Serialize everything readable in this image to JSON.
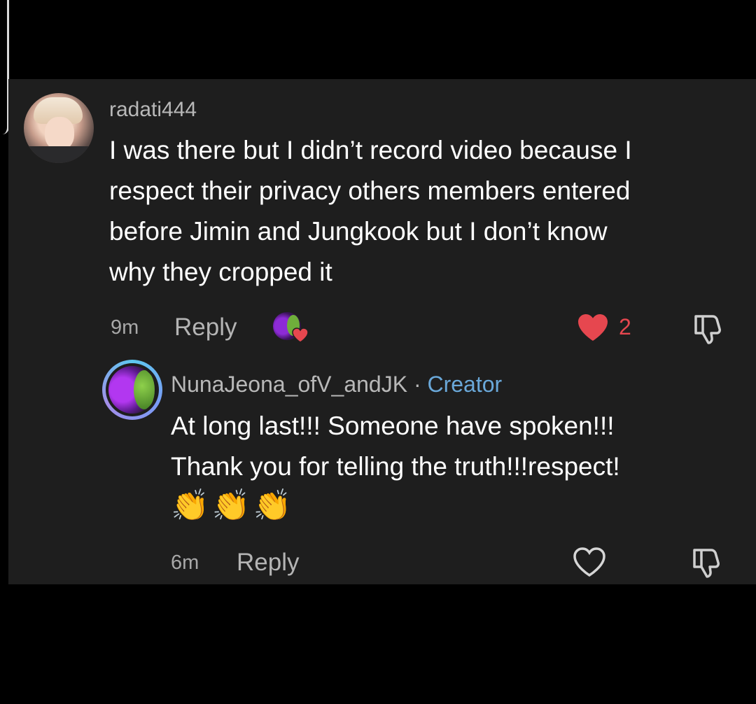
{
  "comment": {
    "username": "radati444",
    "text": "I was there but I didn’t record video because I\nrespect their privacy others members entered\nbefore Jimin and Jungkook but I don’t know\nwhy they cropped it",
    "time": "9m",
    "reply_label": "Reply",
    "like_count": "2",
    "liked_by_creator": true
  },
  "reply": {
    "username": "NunaJeona_ofV_andJK",
    "separator": " · ",
    "badge": "Creator",
    "text": "At long last!!! Someone have spoken!!!\nThank you for telling the truth!!!respect!",
    "emojis": "👏👏👏",
    "time": "6m",
    "reply_label": "Reply"
  },
  "colors": {
    "panel": "#1e1e1e",
    "like_red": "#e6474f",
    "creator_blue": "#6aa8d9"
  }
}
